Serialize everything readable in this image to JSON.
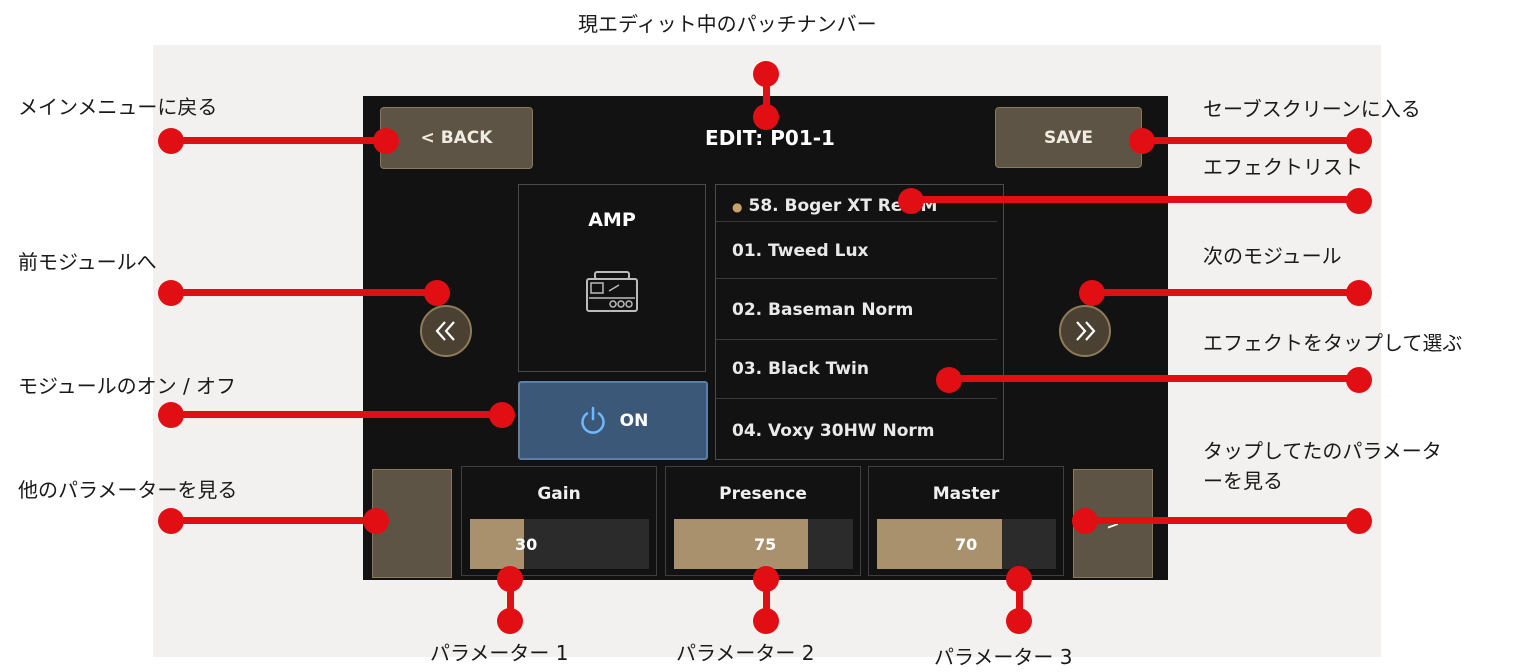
{
  "header_annotation": "現エディット中のパッチナンバー",
  "device": {
    "back_label": "< BACK",
    "title": "EDIT: P01-1",
    "save_label": "SAVE",
    "module_name": "AMP",
    "power_label": "ON",
    "effects": [
      "58. Boger XT Red M",
      "01. Tweed Lux",
      "02. Baseman Norm",
      "03. Black Twin",
      "04. Voxy 30HW Norm"
    ],
    "prev_symbol": "«",
    "next_symbol": "»",
    "params": [
      {
        "name": "Gain",
        "value": "30",
        "level": 0.3
      },
      {
        "name": "Presence",
        "value": "75",
        "level": 0.75
      },
      {
        "name": "Master",
        "value": "70",
        "level": 0.7
      }
    ],
    "more_params_symbol": ">"
  },
  "labels": {
    "main_menu": "メインメニューに戻る",
    "save_screen": "セーブスクリーンに入る",
    "effect_list": "エフェクトリスト",
    "prev_module": "前モジュールへ",
    "next_module": "次のモジュール",
    "tap_select": "エフェクトをタップして選ぶ",
    "module_onoff": "モジュールのオン / オフ",
    "other_params": "他のパラメーターを見る",
    "tapped_params": "タップしてたのパラメータ\nーを見る",
    "param1": "パラメーター 1",
    "param2": "パラメーター 2",
    "param3": "パラメーター 3"
  },
  "colors": {
    "annotation_red": "#e10f13",
    "button_tan": "#5e5445",
    "power_blue": "#3b5878",
    "slider_fill": "#a8916c"
  }
}
